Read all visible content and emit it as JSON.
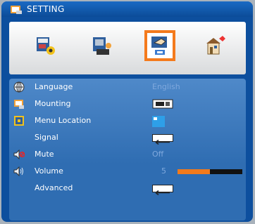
{
  "title": {
    "text": "SETTING"
  },
  "colors": {
    "accent": "#f47a1c",
    "panel": "#0d4f9e",
    "menu_bg": "#2f6db2",
    "value_text": "#7fa8dd"
  },
  "tabs": [
    {
      "name": "image-tab",
      "icon": "image-settings-icon",
      "selected": false
    },
    {
      "name": "display-tab",
      "icon": "display-settings-icon",
      "selected": false
    },
    {
      "name": "setting-tab",
      "icon": "setting-hand-icon",
      "selected": true
    },
    {
      "name": "options-tab",
      "icon": "options-house-icon",
      "selected": false
    }
  ],
  "menu": {
    "language": {
      "label": "Language",
      "value": "English"
    },
    "mounting": {
      "label": "Mounting"
    },
    "menu_location": {
      "label": "Menu Location"
    },
    "signal": {
      "label": "Signal"
    },
    "mute": {
      "label": "Mute",
      "value": "Off"
    },
    "volume": {
      "label": "Volume",
      "value": "5",
      "level_fraction": 0.5
    },
    "advanced": {
      "label": "Advanced"
    }
  }
}
